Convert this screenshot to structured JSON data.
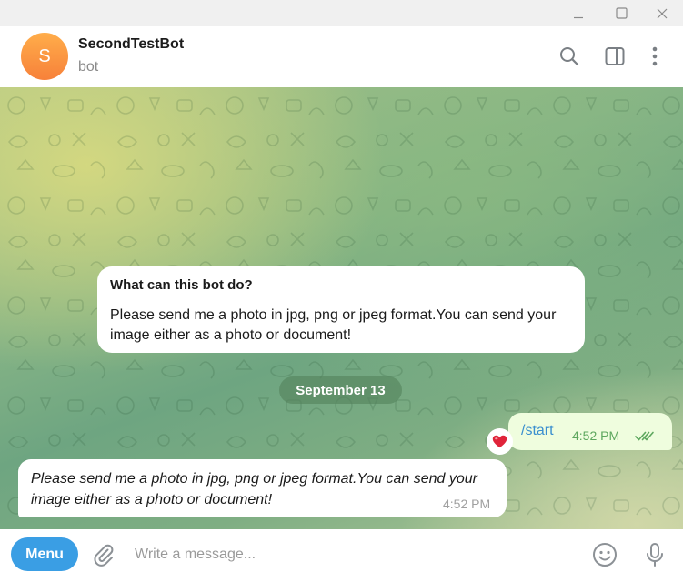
{
  "window": {
    "controls": [
      "minimize-icon",
      "maximize-icon",
      "close-icon"
    ]
  },
  "header": {
    "avatar_letter": "S",
    "peer_name": "SecondTestBot",
    "peer_status": "bot",
    "icons": [
      "search-icon",
      "sidebar-toggle-icon",
      "more-vertical-icon"
    ]
  },
  "chat": {
    "bot_info": {
      "title": "What can this bot do?",
      "text": "Please send me a photo in jpg, png or jpeg format.You can send your image either as a photo or document!"
    },
    "date_separator": "September 13",
    "messages": [
      {
        "direction": "outgoing",
        "text": "/start",
        "time": "4:52 PM",
        "status": "read",
        "reaction": "heart"
      },
      {
        "direction": "incoming",
        "text": "Please send me a photo in jpg, png or jpeg format.You can send your image either as a photo or document!",
        "time": "4:52 PM"
      }
    ]
  },
  "composer": {
    "menu_label": "Menu",
    "placeholder": "Write a message...",
    "icons": [
      "paperclip-icon",
      "emoji-icon",
      "microphone-icon"
    ]
  },
  "colors": {
    "accent": "#3a9ee4",
    "avatar": "#f7813a",
    "outgoing_bubble": "#effdde",
    "read_check": "#5da75e",
    "command_link": "#3a8fcf",
    "reaction": "#e0243a"
  }
}
